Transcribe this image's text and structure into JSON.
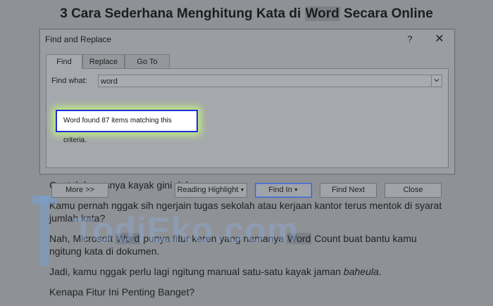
{
  "article": {
    "title_pre": "3 Cara Sederhana Menghitung Kata di ",
    "title_hl": "Word",
    "title_post": " Secara Online",
    "p1": "Contoh kasusnya kayak gini deh…",
    "p2": "Kamu pernah nggak sih ngerjain tugas sekolah atau kerjaan kantor terus mentok di syarat jumlah kata?",
    "p3_a": "Nah, Microsoft ",
    "p3_hl1": "Word",
    "p3_b": " punya fitur keren yang namanya ",
    "p3_hl2": "Word",
    "p3_c": " Count buat bantu kamu ngitung kata di dokumen.",
    "p4_a": "Jadi, kamu nggak perlu lagi ngitung manual satu-satu kayak jaman ",
    "p4_em": "baheula",
    "p4_b": ".",
    "p5": "Kenapa Fitur Ini Penting Banget?"
  },
  "watermark": {
    "text": "TodiEko.com"
  },
  "dialog": {
    "title": "Find and Replace",
    "help_glyph": "?",
    "close_glyph": "✕",
    "tabs": [
      {
        "label": "Find",
        "active": true
      },
      {
        "label": "Replace",
        "active": false
      },
      {
        "label": "Go To",
        "active": false
      }
    ],
    "find_label": "Find what:",
    "find_value": "word",
    "result_message": "Word found 87 items matching this criteria.",
    "buttons": {
      "more": "More >>",
      "reading_highlight": "Reading Highlight",
      "find_in": "Find In",
      "find_next": "Find Next",
      "close": "Close"
    }
  },
  "colors": {
    "overlay_bg": "#8e9196",
    "result_border": "#1a2fd6",
    "result_glow": "#c8ff78"
  }
}
